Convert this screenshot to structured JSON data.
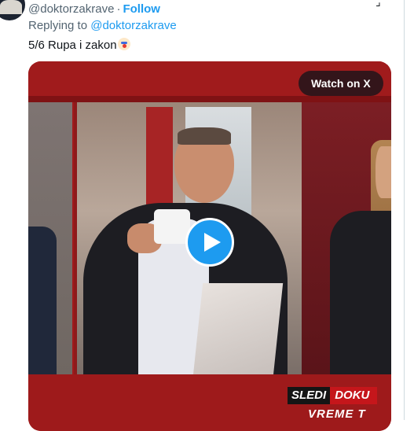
{
  "tweet": {
    "handle": "@doktorzakrave",
    "separator": "·",
    "follow_label": "Follow",
    "replying_prefix": "Replying to ",
    "replying_to": "@doktorzakrave",
    "text": "5/6 Rupa i zakon",
    "emoji_icon": "clown-face-icon"
  },
  "video": {
    "watch_label": "Watch on X",
    "ticker_main": "SLEDI",
    "ticker_next": "DOKU",
    "ticker_second": "VREME T"
  },
  "colors": {
    "accent": "#1d9bf0",
    "muted": "#536471",
    "broadcast_red": "#a01b1c"
  }
}
